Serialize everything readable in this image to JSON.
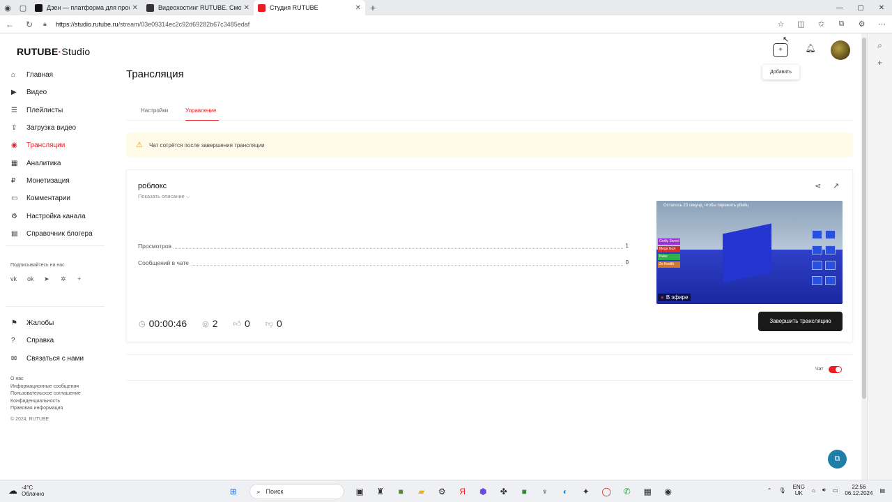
{
  "browser": {
    "tabs": [
      {
        "title": "Дзен — платформа для просмо",
        "color": "#111111"
      },
      {
        "title": "Видеохостинг RUTUBE. Смотрит",
        "color": "#222222"
      },
      {
        "title": "Студия RUTUBE",
        "color": "#ed1c24",
        "active": true
      }
    ],
    "url_host": "https://studio.rutube.ru",
    "url_path": "/stream/03e09314ec2c92d69282b67c3485edaf"
  },
  "app": {
    "logo_main": "RUTUBE",
    "logo_studio": "Studio",
    "page_title": "Трансляция",
    "add_tooltip": "Добавить"
  },
  "sidebar": {
    "items": [
      {
        "label": "Главная",
        "icon": "home-icon"
      },
      {
        "label": "Видео",
        "icon": "video-icon"
      },
      {
        "label": "Плейлисты",
        "icon": "playlist-icon"
      },
      {
        "label": "Загрузка видео",
        "icon": "upload-icon"
      },
      {
        "label": "Трансляции",
        "icon": "broadcast-icon",
        "active": true
      },
      {
        "label": "Аналитика",
        "icon": "analytics-icon"
      },
      {
        "label": "Монетизация",
        "icon": "money-icon"
      },
      {
        "label": "Комментарии",
        "icon": "comments-icon"
      },
      {
        "label": "Настройка канала",
        "icon": "settings-icon"
      },
      {
        "label": "Справочник блогера",
        "icon": "book-icon"
      }
    ],
    "subscribe_label": "Подписывайтесь на нас",
    "social": [
      "vk-icon",
      "ok-icon",
      "telegram-icon",
      "dzen-icon",
      "plus-icon"
    ],
    "items2": [
      {
        "label": "Жалобы",
        "icon": "flag-icon"
      },
      {
        "label": "Справка",
        "icon": "help-icon"
      },
      {
        "label": "Связаться с нами",
        "icon": "mail-icon"
      }
    ],
    "footer_links": [
      "О нас",
      "Информационные сообщения",
      "Пользовательское соглашение",
      "Конфиденциальность",
      "Правовая информация"
    ],
    "copyright": "© 2024, RUTUBE"
  },
  "tabs": {
    "settings": "Настройки",
    "control": "Управление"
  },
  "warning": "Чат сотрётся после завершения трансляции",
  "stream": {
    "name": "роблокс",
    "show_description": "Показать описание",
    "stats": [
      {
        "label": "Просмотров",
        "value": "1"
      },
      {
        "label": "Сообщений в чате",
        "value": "0"
      }
    ],
    "duration": "00:00:46",
    "viewers": "2",
    "likes": "0",
    "dislikes": "0",
    "end_button": "Завершить трансляцию",
    "preview": {
      "top_text": "Осталось 23 секунд, чтобы пережить убийц",
      "items": [
        {
          "label": "Godly Sword",
          "color": "#9b2fd0"
        },
        {
          "label": "Mega Gun",
          "color": "#d02f2f"
        },
        {
          "label": "Nuke",
          "color": "#2fb04a"
        },
        {
          "label": "2x Health",
          "color": "#d07a2f"
        }
      ],
      "on_air": "В эфире"
    }
  },
  "chat": {
    "label": "Чат",
    "enabled": true
  },
  "taskbar": {
    "temperature": "-4°C",
    "weather": "Облачно",
    "search": "Поиск",
    "lang_1": "ENG",
    "lang_2": "UK",
    "time": "22:56",
    "date": "06.12.2024"
  }
}
